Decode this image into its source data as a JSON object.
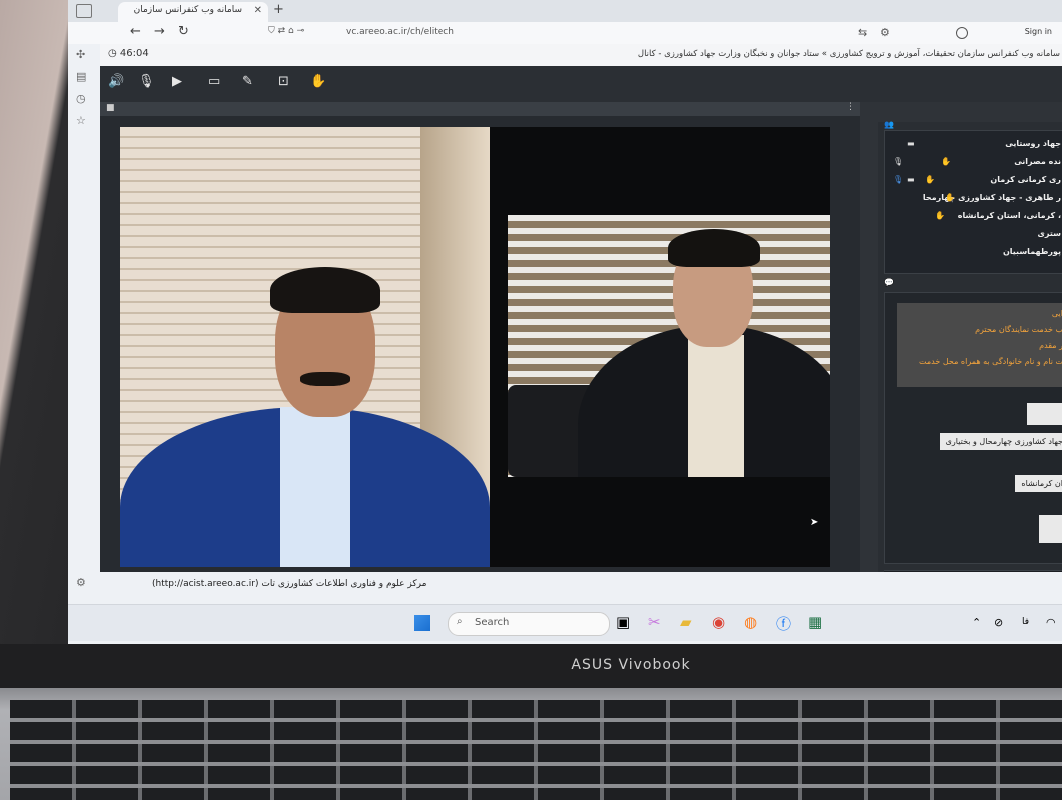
{
  "browser": {
    "tab_title": "سامانه وب کنفرانس سازمان",
    "new_tab": "+",
    "url": "vc.areeo.ac.ir/ch/elitech",
    "sign_in": "Sign in"
  },
  "app": {
    "timer": "46:04",
    "title": "سامانه وب کنفرانس سازمان تحقیقات، آموزش و ترویج کشاورزی » ستاد جوانان و نخبگان وزارت جهاد کشاورزی - کانال",
    "footer": "مرکز علوم و فناوری اطلاعات کشاورزی تات (http://acist.areeo.ac.ir)"
  },
  "participants": [
    "جهاد روستایی",
    "نده مصرانی",
    "ری کرمانی کرمان",
    "ر طاهری - جهاد کشاورزی چهارمحا",
    "، کرمانی، استان کرمانشاه",
    "ستری",
    "پورطهماسبیان"
  ],
  "announcement": [
    "ایی",
    "ب خدمت نمایندگان محترم",
    "ر مقدم",
    "ت نام و نام خانوادگی به همراه محل خدمت"
  ],
  "chat_messages": [
    "جهاد کشاورزی چهارمحال و بختیاری",
    "ان کرمانشاه"
  ],
  "taskbar": {
    "search_placeholder": "Search",
    "lang": "فا"
  },
  "laptop_brand": "ASUS Vivobook"
}
